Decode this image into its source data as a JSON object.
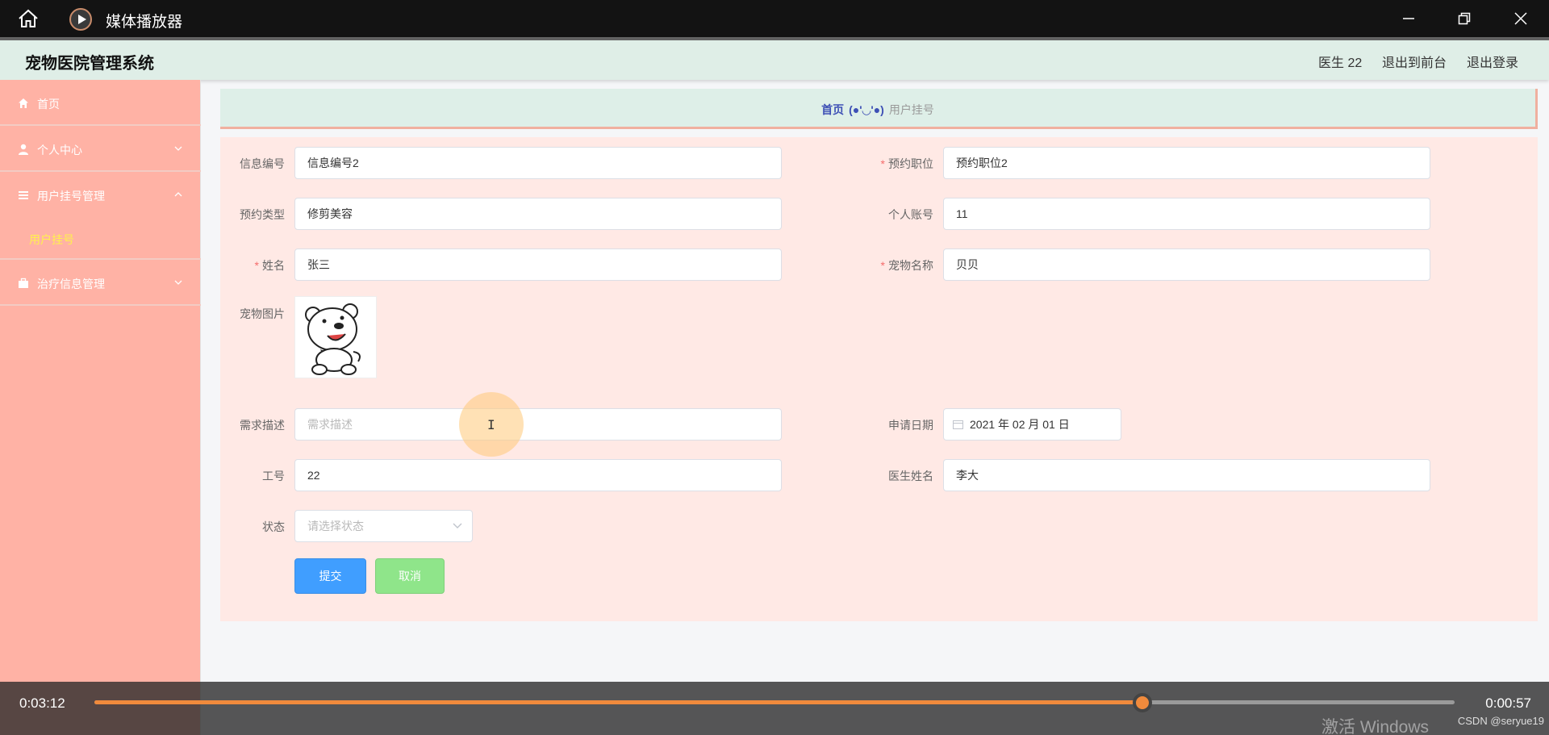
{
  "player": {
    "app_title": "媒体播放器",
    "time_elapsed": "0:03:12",
    "time_remaining": "0:00:57",
    "progress": 0.7706,
    "accent_color": "#f08a3c",
    "watermark": "激活 Windows",
    "credit": "CSDN @seryue19"
  },
  "header": {
    "system_title": "宠物医院管理系统",
    "user": "医生 22",
    "back_to_front": "退出到前台",
    "logout": "退出登录"
  },
  "sidebar": {
    "items": [
      {
        "label": "首页",
        "icon": "home-icon"
      },
      {
        "label": "个人中心",
        "icon": "user-icon"
      },
      {
        "label": "用户挂号管理",
        "icon": "list-icon"
      },
      {
        "label": "治疗信息管理",
        "icon": "briefcase-icon"
      }
    ],
    "sub_item": "用户挂号"
  },
  "breadcrumb": {
    "home": "首页",
    "separator": "(●'◡'●)",
    "current": "用户挂号"
  },
  "form": {
    "info_no": {
      "label": "信息编号",
      "value": "信息编号2"
    },
    "position": {
      "label": "预约职位",
      "value": "预约职位2"
    },
    "type": {
      "label": "预约类型",
      "value": "修剪美容"
    },
    "account": {
      "label": "个人账号",
      "value": "11"
    },
    "name": {
      "label": "姓名",
      "value": "张三"
    },
    "pet_name": {
      "label": "宠物名称",
      "value": "贝贝"
    },
    "pet_pic": {
      "label": "宠物图片"
    },
    "demand": {
      "label": "需求描述",
      "placeholder": "需求描述"
    },
    "apply_date": {
      "label": "申请日期",
      "value": "2021 年 02 月 01 日"
    },
    "work_no": {
      "label": "工号",
      "value": "22"
    },
    "doctor": {
      "label": "医生姓名",
      "value": "李大"
    },
    "status": {
      "label": "状态",
      "placeholder": "请选择状态"
    },
    "required_mark": "*",
    "submit": "提交",
    "cancel": "取消"
  },
  "colors": {
    "sidebar_bg": "#ffb2a5",
    "header_bg": "#dfeee7",
    "form_bg": "#ffe9e5",
    "submit_bg": "#409eff",
    "cancel_bg": "#8fe58a",
    "active_sub_item": "#fff14d"
  }
}
